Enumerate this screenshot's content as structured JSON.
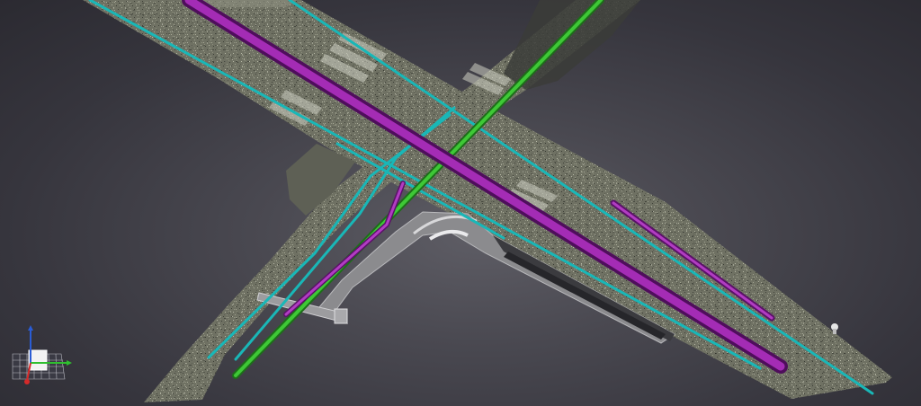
{
  "viewer": {
    "background_color": "#47464e",
    "point_cloud_color": "#7d7f6e",
    "tunnel_color": "#8b8b8e"
  },
  "utilities": {
    "purple_pipe_color": "#8a1d97",
    "green_pipe_color": "#2a9e25",
    "cyan_pipe_color": "#19b7b7"
  },
  "axis_gizmo": {
    "x_axis_color": "#2fbf2f",
    "y_axis_color": "#d42a2a",
    "z_axis_color": "#2a5cd4",
    "icon": "axis-triad-icon"
  }
}
